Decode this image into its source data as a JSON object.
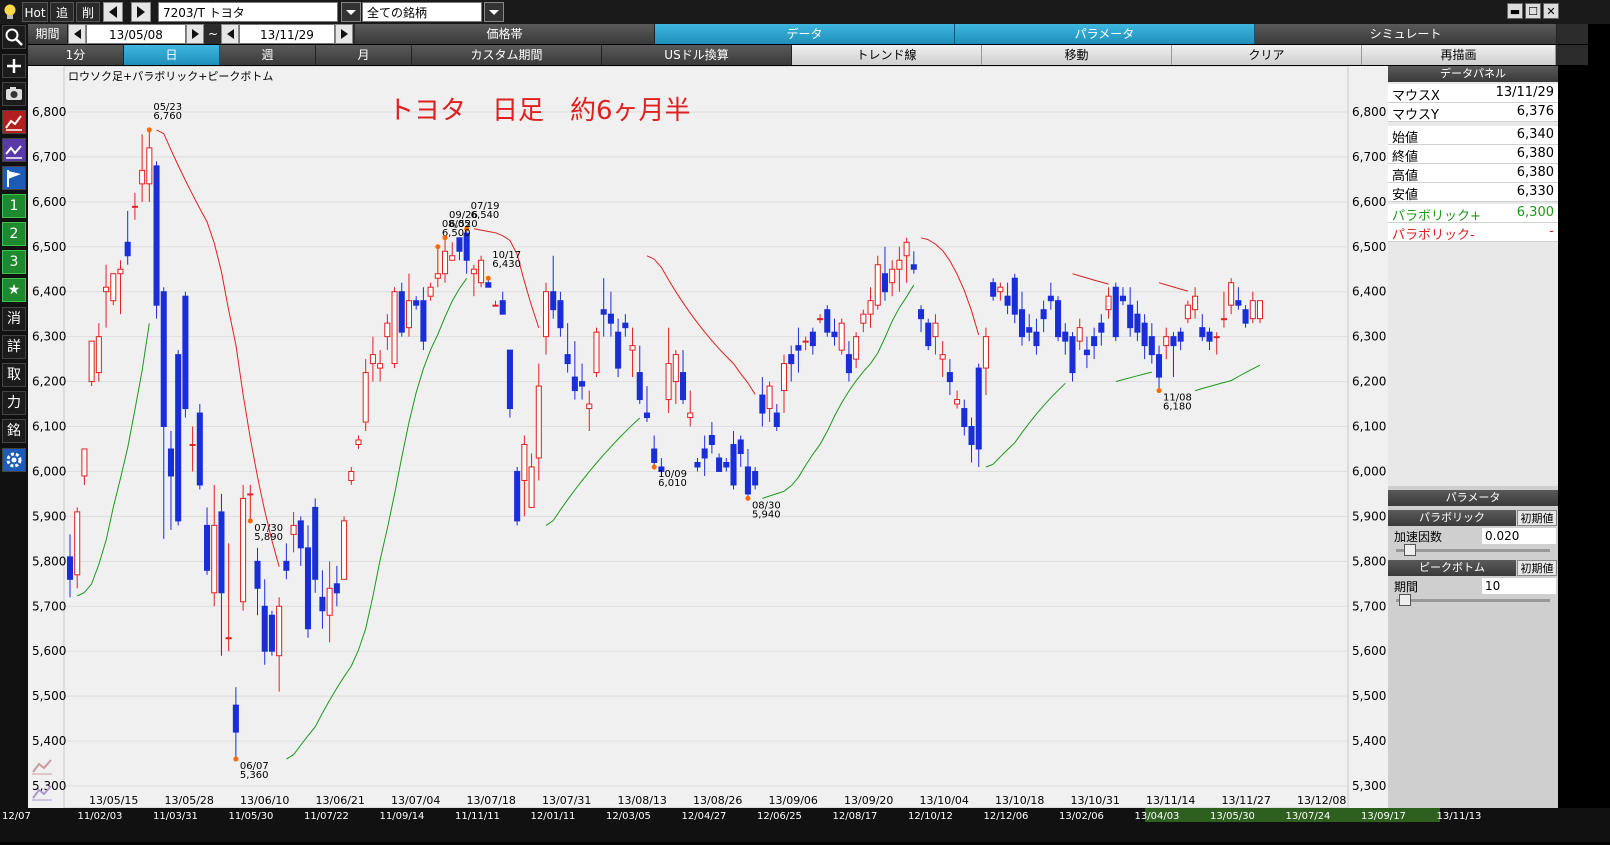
{
  "toolbar": {
    "hot": "Hot",
    "add": "追",
    "del": "削",
    "symbol": "7203/T トヨタ",
    "universe": "全ての銘柄"
  },
  "period_row": {
    "label": "期間",
    "start": "13/05/08",
    "tilde": "~",
    "end": "13/11/29",
    "tabs": [
      "価格帯",
      "データ",
      "パラメータ",
      "シミュレート"
    ]
  },
  "timeframe_row": {
    "tabs": [
      "1分",
      "日",
      "週",
      "月",
      "カスタム期間",
      "USドル換算",
      "トレンド線",
      "移動",
      "クリア",
      "再描画"
    ]
  },
  "left_icons": [
    "search-icon",
    "plus-icon",
    "camera-icon",
    "chart-red-icon",
    "chart-purple-icon",
    "flag-icon",
    "1",
    "2",
    "3",
    "★",
    "消",
    "詳",
    "取",
    "力",
    "銘",
    "gear-icon"
  ],
  "chart_title": "ロウソク足+パラボリック+ピークボトム",
  "annotation": "トヨタ　日足　約6ヶ月半",
  "data_panel": {
    "title": "データパネル",
    "rows": [
      {
        "k": "マウスX",
        "v": "13/11/29"
      },
      {
        "k": "マウスY",
        "v": "6,376"
      },
      {
        "k": "始値",
        "v": "6,340"
      },
      {
        "k": "終値",
        "v": "6,380"
      },
      {
        "k": "高値",
        "v": "6,380"
      },
      {
        "k": "安値",
        "v": "6,330"
      },
      {
        "k": "パラボリック+",
        "v": "6,300"
      },
      {
        "k": "パラボリック-",
        "v": "-"
      }
    ]
  },
  "param_panel": {
    "title": "パラメータ",
    "sections": [
      {
        "name": "パラボリック",
        "reset": "初期値",
        "label": "加速因数",
        "value": "0.020",
        "slider": 0.05
      },
      {
        "name": "ピークボトム",
        "reset": "初期値",
        "label": "期間",
        "value": "10",
        "slider": 0.02
      }
    ]
  },
  "chart_data": {
    "type": "candlestick",
    "title": "ロウソク足+パラボリック+ピークボトム",
    "y_ticks": [
      "6,800",
      "6,700",
      "6,600",
      "6,500",
      "6,400",
      "6,300",
      "6,200",
      "6,100",
      "6,000",
      "5,900",
      "5,800",
      "5,700",
      "5,600",
      "5,500",
      "5,400",
      "5,300"
    ],
    "ylim": [
      5260,
      6880
    ],
    "x_ticks": [
      "13/05/15",
      "13/05/28",
      "13/06/10",
      "13/06/21",
      "13/07/04",
      "13/07/18",
      "13/07/31",
      "13/08/13",
      "13/08/26",
      "13/09/06",
      "13/09/20",
      "13/10/04",
      "13/10/18",
      "13/10/31",
      "13/11/14",
      "13/11/27",
      "13/12/08"
    ],
    "peaks_bottoms": [
      {
        "date": "05/23",
        "value": "6,760",
        "kind": "peak"
      },
      {
        "date": "06/07",
        "value": "5,360",
        "kind": "bottom"
      },
      {
        "date": "07/19",
        "value": "6,540",
        "kind": "peak"
      },
      {
        "date": "07/30",
        "value": "5,890",
        "kind": "bottom"
      },
      {
        "date": "08/05",
        "value": "6,500",
        "kind": "peak"
      },
      {
        "date": "08/30",
        "value": "5,940",
        "kind": "bottom"
      },
      {
        "date": "09/26",
        "value": "6,520",
        "kind": "peak"
      },
      {
        "date": "10/09",
        "value": "6,010",
        "kind": "bottom"
      },
      {
        "date": "10/17",
        "value": "6,430",
        "kind": "peak"
      },
      {
        "date": "11/08",
        "value": "6,180",
        "kind": "bottom"
      }
    ],
    "candles": [
      [
        5810,
        5860,
        5720,
        5760
      ],
      [
        5770,
        5920,
        5740,
        5910
      ],
      [
        5990,
        6050,
        5970,
        6050
      ],
      [
        6200,
        6290,
        6190,
        6290
      ],
      [
        6220,
        6330,
        6200,
        6300
      ],
      [
        6400,
        6460,
        6320,
        6410
      ],
      [
        6380,
        6440,
        6370,
        6440
      ],
      [
        6440,
        6470,
        6350,
        6450
      ],
      [
        6510,
        6580,
        6460,
        6480
      ],
      [
        6590,
        6620,
        6560,
        6590
      ],
      [
        6640,
        6750,
        6600,
        6670
      ],
      [
        6640,
        6760,
        6600,
        6720
      ],
      [
        6680,
        6690,
        6340,
        6370
      ],
      [
        6400,
        6410,
        5850,
        6100
      ],
      [
        6050,
        6090,
        5870,
        5990
      ],
      [
        6260,
        6270,
        5880,
        5890
      ],
      [
        6390,
        6400,
        6120,
        6140
      ],
      [
        6060,
        6100,
        6000,
        6060
      ],
      [
        6130,
        6150,
        5960,
        5970
      ],
      [
        5880,
        5920,
        5770,
        5780
      ],
      [
        5730,
        5970,
        5700,
        5880
      ],
      [
        5910,
        5950,
        5590,
        5730
      ],
      [
        5630,
        5840,
        5600,
        5630
      ],
      [
        5480,
        5520,
        5360,
        5420
      ],
      [
        5710,
        5970,
        5690,
        5940
      ],
      [
        5950,
        5970,
        5890,
        5950
      ],
      [
        5800,
        5830,
        5680,
        5740
      ],
      [
        5700,
        5760,
        5570,
        5600
      ],
      [
        5680,
        5690,
        5590,
        5600
      ],
      [
        5590,
        5720,
        5510,
        5700
      ],
      [
        5800,
        5840,
        5760,
        5780
      ],
      [
        5860,
        5910,
        5820,
        5880
      ],
      [
        5890,
        5900,
        5790,
        5830
      ],
      [
        5830,
        5880,
        5630,
        5650
      ],
      [
        5920,
        5940,
        5730,
        5760
      ],
      [
        5720,
        5780,
        5650,
        5690
      ],
      [
        5680,
        5800,
        5620,
        5740
      ],
      [
        5750,
        5790,
        5700,
        5730
      ],
      [
        5760,
        5900,
        5760,
        5890
      ],
      [
        5980,
        6010,
        5970,
        6000
      ],
      [
        6060,
        6080,
        6050,
        6070
      ],
      [
        6110,
        6250,
        6090,
        6220
      ],
      [
        6240,
        6300,
        6200,
        6260
      ],
      [
        6230,
        6270,
        6200,
        6240
      ],
      [
        6300,
        6350,
        6270,
        6330
      ],
      [
        6240,
        6410,
        6230,
        6400
      ],
      [
        6400,
        6420,
        6300,
        6310
      ],
      [
        6320,
        6440,
        6300,
        6380
      ],
      [
        6380,
        6390,
        6360,
        6370
      ],
      [
        6380,
        6410,
        6270,
        6290
      ],
      [
        6390,
        6420,
        6380,
        6410
      ],
      [
        6430,
        6500,
        6410,
        6440
      ],
      [
        6440,
        6520,
        6420,
        6490
      ],
      [
        6470,
        6510,
        6480,
        6480
      ],
      [
        6520,
        6520,
        6470,
        6490
      ],
      [
        6530,
        6540,
        6440,
        6470
      ],
      [
        6440,
        6460,
        6390,
        6450
      ],
      [
        6420,
        6480,
        6410,
        6470
      ],
      [
        6420,
        6430,
        6410,
        6410
      ],
      [
        6370,
        6380,
        6370,
        6370
      ],
      [
        6380,
        6400,
        6350,
        6350
      ],
      [
        6270,
        6270,
        6120,
        6140
      ],
      [
        6000,
        6010,
        5880,
        5890
      ],
      [
        5980,
        6080,
        5900,
        6060
      ],
      [
        5920,
        6040,
        5920,
        6010
      ],
      [
        6030,
        6240,
        5980,
        6190
      ],
      [
        6300,
        6420,
        6260,
        6400
      ],
      [
        6400,
        6480,
        6340,
        6360
      ],
      [
        6380,
        6400,
        6300,
        6320
      ],
      [
        6260,
        6330,
        6220,
        6240
      ],
      [
        6210,
        6290,
        6160,
        6180
      ],
      [
        6200,
        6240,
        6160,
        6190
      ],
      [
        6140,
        6180,
        6090,
        6150
      ],
      [
        6220,
        6320,
        6210,
        6310
      ],
      [
        6360,
        6430,
        6300,
        6350
      ],
      [
        6350,
        6400,
        6300,
        6330
      ],
      [
        6310,
        6340,
        6210,
        6230
      ],
      [
        6330,
        6350,
        6300,
        6320
      ],
      [
        6270,
        6320,
        6210,
        6280
      ],
      [
        6220,
        6280,
        6150,
        6160
      ],
      [
        6130,
        6190,
        6110,
        6120
      ],
      [
        6050,
        6080,
        6010,
        6020
      ],
      [
        6010,
        6030,
        5990,
        6000
      ],
      [
        6160,
        6320,
        6130,
        6240
      ],
      [
        6200,
        6270,
        6150,
        6260
      ],
      [
        6220,
        6270,
        6150,
        6160
      ],
      [
        6120,
        6180,
        6100,
        6130
      ],
      [
        6020,
        6030,
        6000,
        6010
      ],
      [
        6050,
        6080,
        5990,
        6030
      ],
      [
        6080,
        6110,
        6040,
        6060
      ],
      [
        6030,
        6040,
        6000,
        6000
      ],
      [
        6020,
        6030,
        6000,
        6010
      ],
      [
        6060,
        6090,
        5960,
        5970
      ],
      [
        6070,
        6080,
        6010,
        6040
      ],
      [
        6010,
        6050,
        5940,
        5950
      ],
      [
        6000,
        6010,
        5960,
        5970
      ],
      [
        6170,
        6210,
        6100,
        6130
      ],
      [
        6140,
        6200,
        6110,
        6190
      ],
      [
        6130,
        6150,
        6090,
        6100
      ],
      [
        6180,
        6260,
        6130,
        6240
      ],
      [
        6260,
        6280,
        6200,
        6240
      ],
      [
        6280,
        6320,
        6220,
        6270
      ],
      [
        6290,
        6300,
        6270,
        6290
      ],
      [
        6310,
        6320,
        6260,
        6280
      ],
      [
        6340,
        6350,
        6330,
        6340
      ],
      [
        6360,
        6370,
        6300,
        6310
      ],
      [
        6310,
        6340,
        6280,
        6300
      ],
      [
        6270,
        6340,
        6260,
        6330
      ],
      [
        6260,
        6290,
        6200,
        6220
      ],
      [
        6250,
        6310,
        6230,
        6300
      ],
      [
        6330,
        6360,
        6310,
        6350
      ],
      [
        6350,
        6410,
        6320,
        6380
      ],
      [
        6370,
        6480,
        6360,
        6460
      ],
      [
        6440,
        6500,
        6380,
        6400
      ],
      [
        6420,
        6470,
        6390,
        6450
      ],
      [
        6450,
        6500,
        6400,
        6470
      ],
      [
        6480,
        6520,
        6420,
        6510
      ],
      [
        6460,
        6490,
        6440,
        6450
      ],
      [
        6360,
        6370,
        6310,
        6340
      ],
      [
        6330,
        6340,
        6270,
        6280
      ],
      [
        6300,
        6350,
        6260,
        6330
      ],
      [
        6250,
        6290,
        6210,
        6260
      ],
      [
        6220,
        6250,
        6170,
        6200
      ],
      [
        6150,
        6180,
        6140,
        6160
      ],
      [
        6140,
        6160,
        6080,
        6100
      ],
      [
        6100,
        6120,
        6020,
        6060
      ],
      [
        6230,
        6240,
        6010,
        6050
      ],
      [
        6230,
        6320,
        6170,
        6300
      ],
      [
        6420,
        6430,
        6380,
        6390
      ],
      [
        6400,
        6420,
        6380,
        6410
      ],
      [
        6390,
        6420,
        6350,
        6370
      ],
      [
        6430,
        6440,
        6330,
        6350
      ],
      [
        6360,
        6400,
        6280,
        6300
      ],
      [
        6320,
        6350,
        6290,
        6310
      ],
      [
        6310,
        6340,
        6260,
        6280
      ],
      [
        6360,
        6380,
        6310,
        6340
      ],
      [
        6390,
        6420,
        6360,
        6380
      ],
      [
        6380,
        6390,
        6290,
        6300
      ],
      [
        6310,
        6330,
        6260,
        6290
      ],
      [
        6300,
        6310,
        6200,
        6220
      ],
      [
        6290,
        6340,
        6270,
        6320
      ],
      [
        6270,
        6300,
        6230,
        6260
      ],
      [
        6300,
        6320,
        6250,
        6280
      ],
      [
        6330,
        6350,
        6280,
        6310
      ],
      [
        6360,
        6410,
        6340,
        6390
      ],
      [
        6410,
        6420,
        6290,
        6300
      ],
      [
        6390,
        6410,
        6370,
        6380
      ],
      [
        6370,
        6410,
        6300,
        6320
      ],
      [
        6350,
        6380,
        6290,
        6310
      ],
      [
        6330,
        6350,
        6250,
        6280
      ],
      [
        6300,
        6330,
        6240,
        6260
      ],
      [
        6260,
        6280,
        6180,
        6210
      ],
      [
        6280,
        6320,
        6250,
        6300
      ],
      [
        6300,
        6310,
        6210,
        6280
      ],
      [
        6310,
        6320,
        6270,
        6290
      ],
      [
        6340,
        6380,
        6330,
        6370
      ],
      [
        6360,
        6410,
        6340,
        6390
      ],
      [
        6320,
        6350,
        6290,
        6300
      ],
      [
        6310,
        6320,
        6270,
        6290
      ],
      [
        6300,
        6310,
        6260,
        6300
      ],
      [
        6340,
        6400,
        6320,
        6340
      ],
      [
        6370,
        6430,
        6350,
        6420
      ],
      [
        6380,
        6410,
        6360,
        6370
      ],
      [
        6360,
        6370,
        6320,
        6330
      ],
      [
        6340,
        6400,
        6330,
        6380
      ],
      [
        6340,
        6380,
        6330,
        6380
      ]
    ]
  },
  "bottom_dates": [
    "12/07",
    "11/02/03",
    "11/03/31",
    "11/05/30",
    "11/07/22",
    "11/09/14",
    "11/11/11",
    "12/01/11",
    "12/03/05",
    "12/04/27",
    "12/06/25",
    "12/08/17",
    "12/10/12",
    "12/12/06",
    "13/02/06",
    "13/04/03",
    "13/05/30",
    "13/07/24",
    "13/09/17",
    "13/11/13"
  ]
}
